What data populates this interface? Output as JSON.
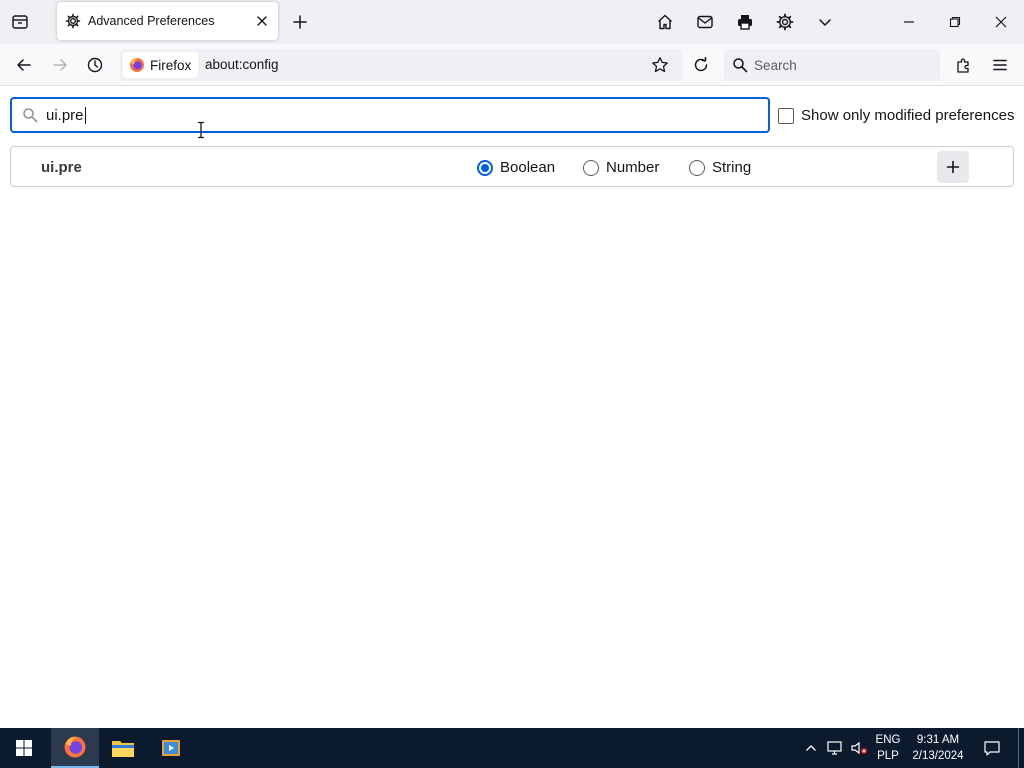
{
  "browser": {
    "tab": {
      "title": "Advanced Preferences"
    },
    "urlbar": {
      "identity_label": "Firefox",
      "url": "about:config"
    },
    "search": {
      "placeholder": "Search"
    }
  },
  "config": {
    "filter_value": "ui.pre",
    "show_modified_label": "Show only modified preferences",
    "new_pref": {
      "name": "ui.pre",
      "types": [
        "Boolean",
        "Number",
        "String"
      ],
      "selected_type": "Boolean"
    }
  },
  "taskbar": {
    "language": "ENG",
    "layout": "PLP",
    "time": "9:31 AM",
    "date": "2/13/2024"
  },
  "colors": {
    "accent": "#0061e0",
    "taskbar": "#0c1a2e",
    "tabstrip": "#f0f0f4"
  }
}
